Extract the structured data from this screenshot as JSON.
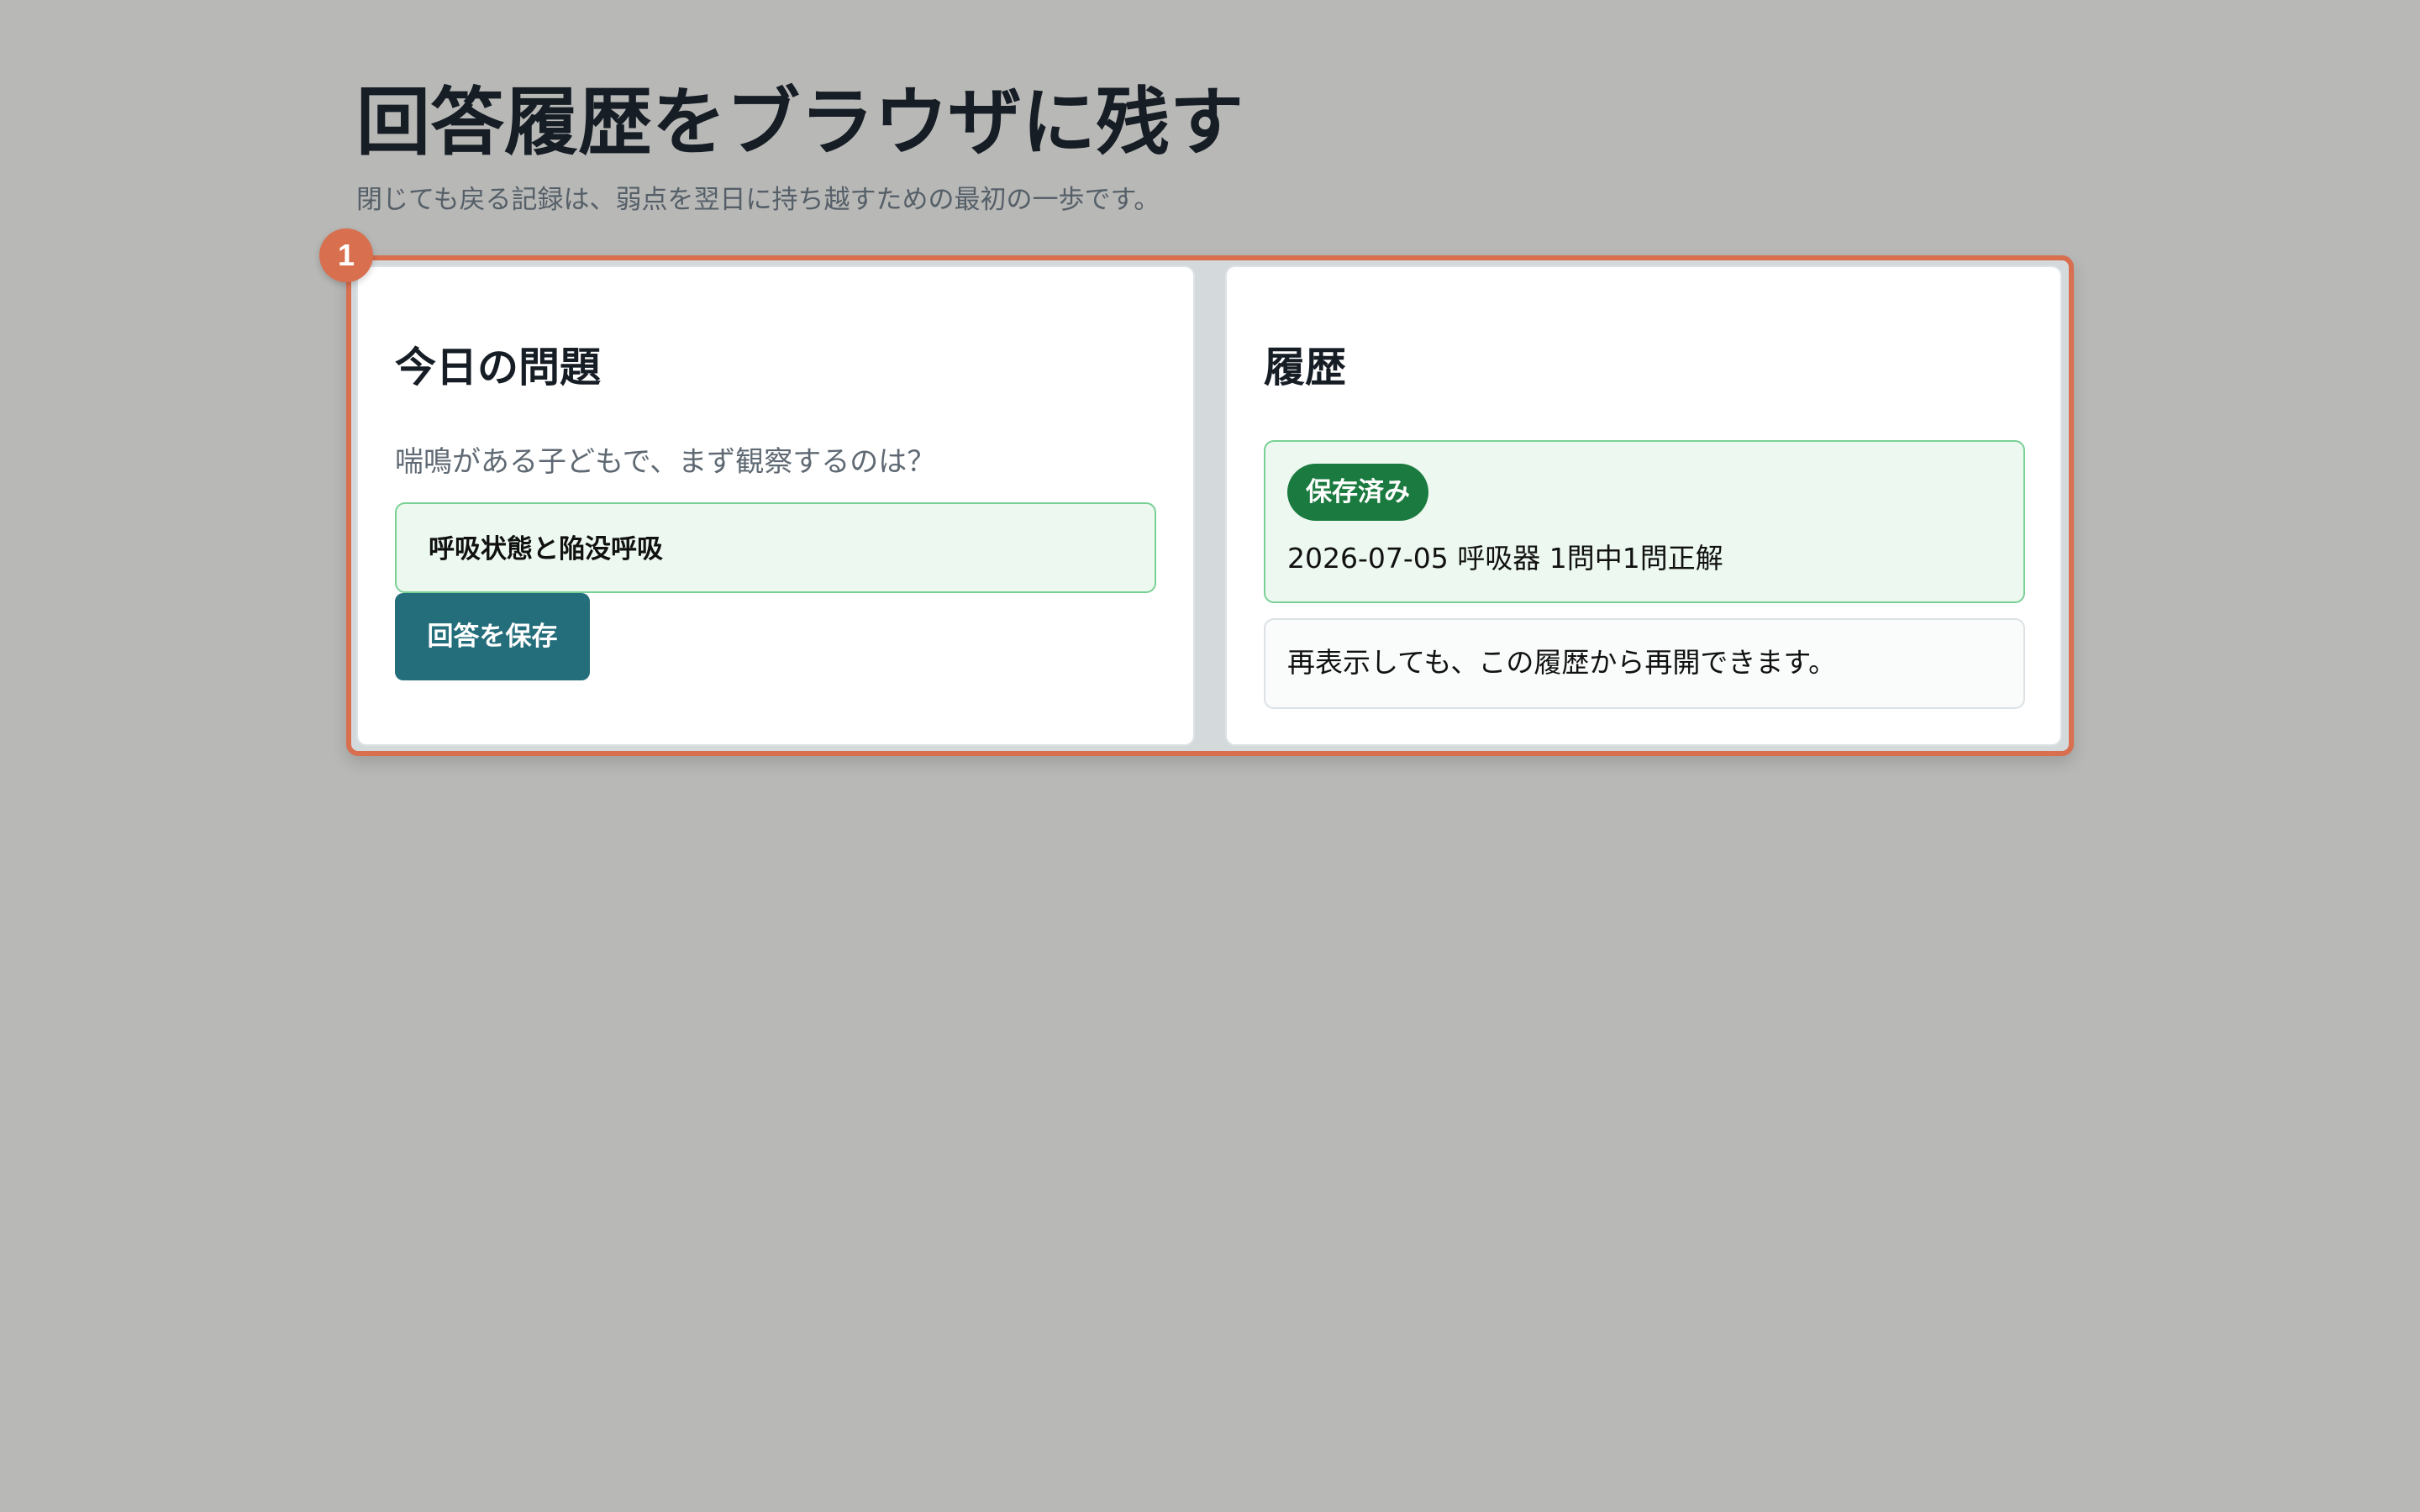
{
  "header": {
    "title": "回答履歴をブラウザに残す",
    "subtitle": "閉じても戻る記録は、弱点を翌日に持ち越すための最初の一歩です。"
  },
  "focus": {
    "badge": "1",
    "accent_color": "#d86f4f"
  },
  "today": {
    "heading": "今日の問題",
    "question": "喘鳴がある子どもで、まず観察するのは？",
    "selected_answer": "呼吸状態と陥没呼吸",
    "save_label": "回答を保存",
    "button_color": "#246d7a"
  },
  "history": {
    "heading": "履歴",
    "status_label": "保存済み",
    "status_color": "#1b7a3f",
    "entry": "2026-07-05 呼吸器 1問中1問正解",
    "resume_note": "再表示しても、この履歴から再開できます。"
  }
}
